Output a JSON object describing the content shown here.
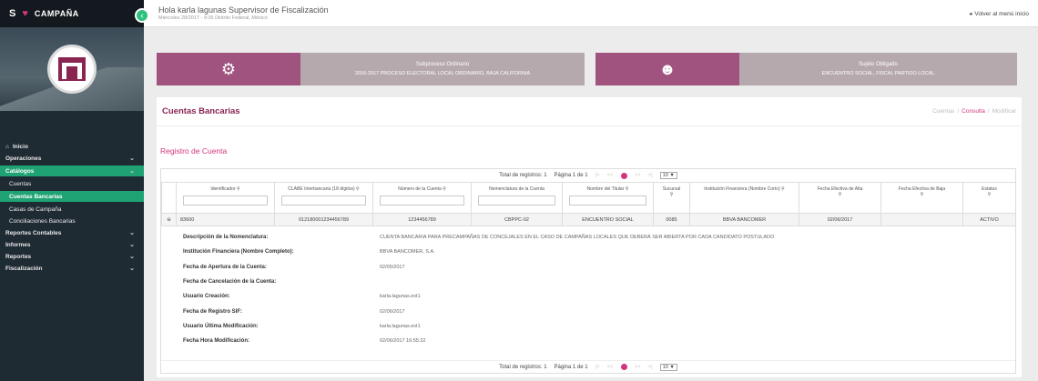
{
  "sidebar": {
    "brand_letter": "S",
    "brand_title": "CAMPAÑA",
    "menu": {
      "home": "Inicio",
      "operaciones": "Operaciones",
      "catalogos": "Catálogos",
      "cuentas": "Cuentas",
      "cuentas_bancarias": "Cuentas Bancarias",
      "casas": "Casas de Campaña",
      "conciliaciones": "Conciliaciones Bancarias",
      "reportes_contables": "Reportes Contables",
      "informes": "Informes",
      "reportes": "Reportes",
      "fiscalizacion": "Fiscalización"
    }
  },
  "topbar": {
    "greeting": "Hola karla lagunas Supervisor de Fiscalización",
    "subtitle": "Miércoles 28/2017 - 9:35 Distrito Federal, México",
    "back_label": "Volver al menú inicio"
  },
  "cards": {
    "left": {
      "line1": "Subproceso Ordinario",
      "line2": "2016-2017 PROCESO ELECTORAL LOCAL ORDINARIO, BAJA CALIFORNIA"
    },
    "right": {
      "line1": "Sujeto Obligado",
      "line2": "ENCUENTRO SOCIAL, FISCAL PARTIDO LOCAL"
    }
  },
  "panel": {
    "title": "Cuentas Bancarias",
    "breadcrumb": [
      "Cuentas",
      "Consulta",
      "Modificar"
    ],
    "section_title": "Registro de Cuenta"
  },
  "pager": {
    "total_label": "Total de registros: 1",
    "page_label": "Página 1 de 1",
    "first": "|<",
    "prev": "<<",
    "next": ">>",
    "last": ">|",
    "page_size": "10 ▼"
  },
  "table": {
    "headers": [
      "Identificador",
      "CLABE Interbancaria (18 dígitos)",
      "Número de la Cuenta",
      "Nomenclatura de la Cuenta",
      "Nombre del Titular",
      "Sucursal",
      "Institución Financiera (Nombre Corto)",
      "Fecha Efectiva de Alta",
      "Fecha Efectiva de Baja",
      "Estatus"
    ],
    "row": {
      "expand": "⊖",
      "identificador": "83600",
      "clabe": "012180001234456789",
      "numero": "1234456789",
      "nomenclatura": "CBPPC-02",
      "titular": "ENCUENTRO SOCIAL",
      "sucursal": "0085",
      "institucion": "BBVA BANCOMER",
      "fecha_alta": "02/06/2017",
      "fecha_baja": "",
      "estatus": "ACTIVO"
    }
  },
  "details": [
    {
      "label": "Descripción de la Nomenclatura:",
      "value": "CUENTA BANCARIA PARA PRECAMPAÑAS DE CONCEJALES EN EL CASO DE CAMPAÑAS LOCALES QUE DEBERÁ SER ABIERTA POR CADA CANDIDATO POSTULADO"
    },
    {
      "label": "Institución Financiera (Nombre Completo):",
      "value": "BBVA BANCOMER, S.A."
    },
    {
      "label": "Fecha de Apertura de la Cuenta:",
      "value": "02/05/2017"
    },
    {
      "label": "Fecha de Cancelación de la Cuenta:",
      "value": ""
    },
    {
      "label": "Usuario Creación:",
      "value": "karla.lagunas.ext1"
    },
    {
      "label": "Fecha de Registro SIF:",
      "value": "02/06/2017"
    },
    {
      "label": "Usuario Última Modificación:",
      "value": "karla.lagunas.ext1"
    },
    {
      "label": "Fecha Hora Modificación:",
      "value": "02/06/2017 16:55:22"
    }
  ]
}
